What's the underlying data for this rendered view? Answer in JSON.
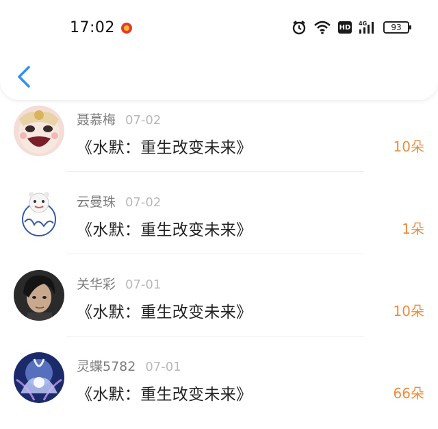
{
  "status_bar": {
    "time": "17:02",
    "battery": "93",
    "network": "4G",
    "hd": "HD"
  },
  "header": {
    "back_icon": "chevron-left-icon"
  },
  "colors": {
    "accent_blue": "#2f8ff0",
    "amount_orange": "#ef8b3a",
    "name_gray": "#7c7c7c",
    "date_gray": "#b8b8b8"
  },
  "records": [
    {
      "name": "聂慕梅",
      "date": "07-02",
      "book": "《水默：重生改变未来》",
      "amount": "10朵"
    },
    {
      "name": "云曼珠",
      "date": "07-02",
      "book": "《水默：重生改变未来》",
      "amount": "1朵"
    },
    {
      "name": "关华彩",
      "date": "07-01",
      "book": "《水默：重生改变未来》",
      "amount": "10朵"
    },
    {
      "name": "灵蝶5782",
      "date": "07-01",
      "book": "《水默：重生改变未来》",
      "amount": "66朵"
    }
  ]
}
